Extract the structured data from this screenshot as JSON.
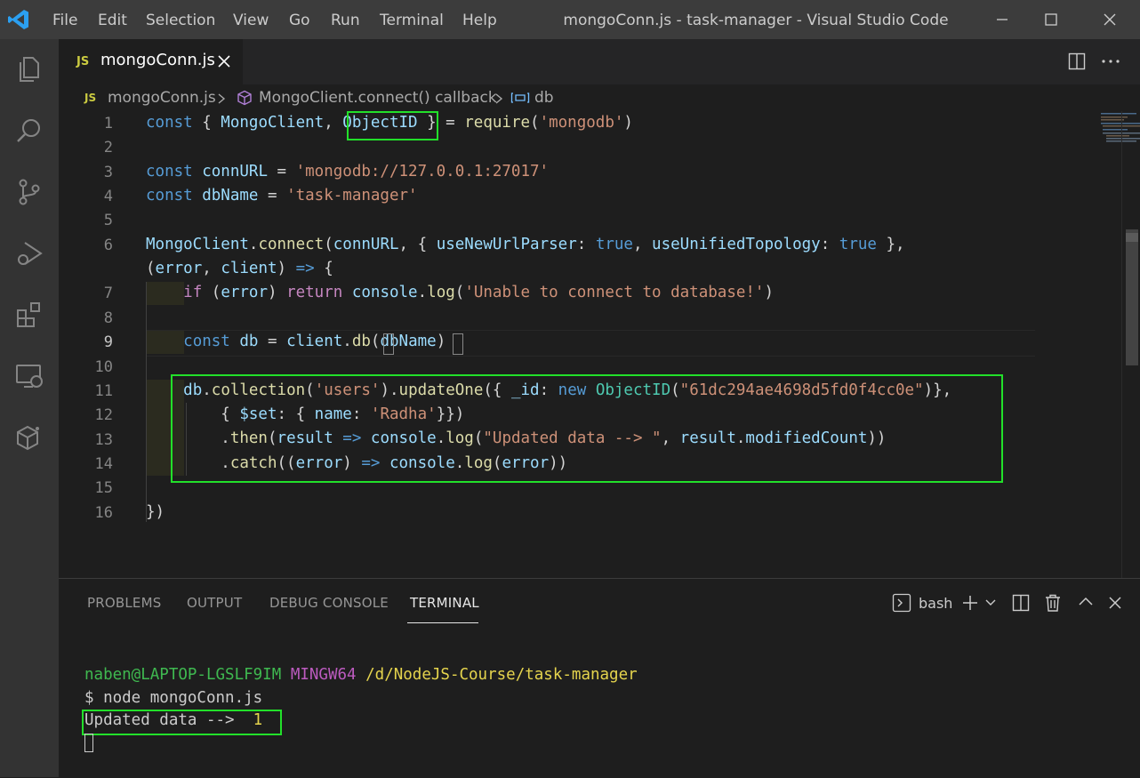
{
  "titlebar": {
    "menu": [
      "File",
      "Edit",
      "Selection",
      "View",
      "Go",
      "Run",
      "Terminal",
      "Help"
    ],
    "window_title": "mongoConn.js - task-manager - Visual Studio Code"
  },
  "tab": {
    "badge": "JS",
    "label": "mongoConn.js"
  },
  "breadcrumb": {
    "file": "mongoConn.js",
    "symbol1": "MongoClient.connect() callback",
    "symbol2": "db"
  },
  "editor": {
    "line_numbers": [
      "1",
      "2",
      "3",
      "4",
      "5",
      "6",
      "",
      "7",
      "8",
      "9",
      "10",
      "11",
      "12",
      "13",
      "14",
      "15",
      "16"
    ],
    "active_line": "9",
    "lines": [
      "const { MongoClient, ObjectID } = require('mongodb')",
      "",
      "const connURL = 'mongodb://127.0.0.1:27017'",
      "const dbName = 'task-manager'",
      "",
      "MongoClient.connect(connURL, { useNewUrlParser: true, useUnifiedTopology: true },",
      "(error, client) => {",
      "    if (error) return console.log('Unable to connect to database!')",
      "",
      "    const db = client.db(dbName)",
      "",
      "    db.collection('users').updateOne({ _id: new ObjectID(\"61dc294ae4698d5fd0f4cc0e\")},",
      "        { $set: { name: 'Radha'}})",
      "        .then(result => console.log(\"Updated data --> \", result.modifiedCount))",
      "        .catch((error) => console.log(error))",
      "",
      "})"
    ]
  },
  "panel": {
    "tabs": [
      "PROBLEMS",
      "OUTPUT",
      "DEBUG CONSOLE",
      "TERMINAL"
    ],
    "active_tab": "TERMINAL",
    "shell": "bash"
  },
  "terminal": {
    "user_host": "naben@LAPTOP-LGSLF9IM",
    "system": "MINGW64",
    "path": "/d/NodeJS-Course/task-manager",
    "command": "$ node mongoConn.js",
    "output_label": "Updated data -->",
    "output_value": "1"
  },
  "colors": {
    "highlight_box": "#22e02a",
    "editor_bg": "#1e1e1e",
    "titlebar_bg": "#3c3c3c"
  }
}
